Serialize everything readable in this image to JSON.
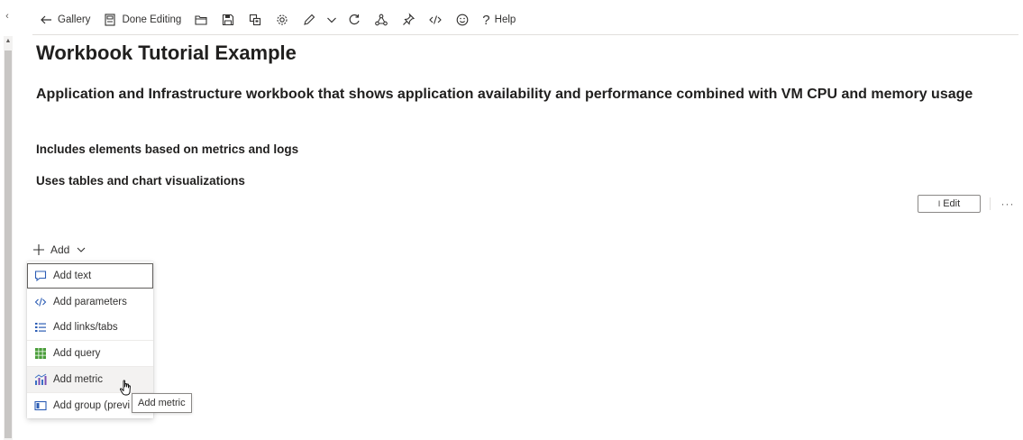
{
  "toolbar": {
    "gallery_label": "Gallery",
    "done_editing_label": "Done Editing",
    "help_label": "Help",
    "icons": [
      "back-arrow-icon",
      "done-editing-icon",
      "open-folder-icon",
      "save-icon",
      "copy-icon",
      "settings-gear-icon",
      "pencil-edit-icon",
      "chevron-down-icon",
      "refresh-icon",
      "share-icon",
      "pin-icon",
      "code-icon",
      "smiley-feedback-icon",
      "help-question-icon"
    ]
  },
  "content": {
    "title": "Workbook Tutorial Example",
    "subtitle": "Application and Infrastructure workbook that shows application availability and performance combined with VM CPU and memory usage",
    "line1": "Includes elements based on metrics and logs",
    "line2": "Uses tables and chart visualizations"
  },
  "edit": {
    "label": "Edit",
    "more": "···"
  },
  "add": {
    "label": "Add",
    "menu": [
      {
        "label": "Add text",
        "icon": "comment-icon"
      },
      {
        "label": "Add parameters",
        "icon": "code-icon"
      },
      {
        "label": "Add links/tabs",
        "icon": "list-icon"
      },
      {
        "label": "Add query",
        "icon": "grid-icon"
      },
      {
        "label": "Add metric",
        "icon": "metric-chart-icon"
      },
      {
        "label": "Add group (previ",
        "icon": "group-icon"
      }
    ],
    "tooltip": "Add metric"
  },
  "colors": {
    "text": "#201f1e",
    "border": "#8a8886",
    "grid_green": "#4a9d3a",
    "link_blue": "#2b5cb4",
    "metric_blue": "#3a6fc4",
    "metric_purple": "#7a4fb5"
  }
}
